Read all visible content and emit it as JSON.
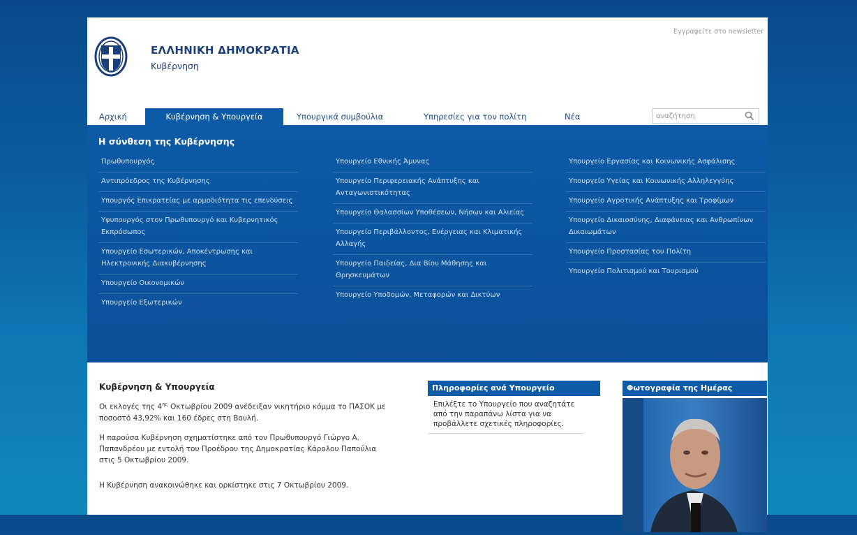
{
  "header": {
    "title": "ΕΛΛΗΝΙΚΗ ΔΗΜΟΚΡΑΤΙΑ",
    "subtitle": "Κυβέρνηση",
    "newsletter": "Εγγραφείτε στο newsletter",
    "logo_icon": "greek-coat-of-arms"
  },
  "nav": {
    "items": [
      {
        "label": "Αρχική"
      },
      {
        "label": "Κυβέρνηση & Υπουργεία",
        "active": true
      },
      {
        "label": "Υπουργικά συμβούλια"
      },
      {
        "label": "Υπηρεσίες για τον πολίτη"
      },
      {
        "label": "Νέα"
      }
    ],
    "search_placeholder": "αναζήτηση",
    "search_icon": "magnifier-icon"
  },
  "mega": {
    "title": "Η σύνθεση της Κυβέρνησης",
    "col1": [
      "Πρωθυπουργός",
      "Αντιπρόεδρος της Κυβέρνησης",
      "Υπουργός Επικρατείας με αρμοδιότητα τις επενδύσεις",
      "Υφυπουργός στον Πρωθυπουργό και Κυβερνητικός Εκπρόσωπος",
      "Υπουργείο Εσωτερικών, Αποκέντρωσης και Ηλεκτρονικής Διακυβέρνησης",
      "Υπουργείο Οικονομικών",
      "Υπουργείο Εξωτερικών"
    ],
    "col2": [
      "Υπουργείο Εθνικής Άμυνας",
      "Υπουργείο Περιφερειακής Ανάπτυξης και Ανταγωνιστικότητας",
      "Υπουργείο Θαλασσίων Υποθέσεων, Νήσων και Αλιείας",
      "Υπουργείο Περιβάλλοντος, Ενέργειας και Κλιματικής Αλλαγής",
      "Υπουργείο Παιδείας, Δια Βίου Μάθησης και Θρησκευμάτων",
      "Υπουργείο Υποδομών, Μεταφορών και Δικτύων"
    ],
    "col3": [
      "Υπουργείο Εργασίας και Κοινωνικής Ασφάλισης",
      "Υπουργείο Υγείας και Κοινωνικής Αλληλεγγύης",
      "Υπουργείο Αγροτικής Ανάπτυξης και Τροφίμων",
      "Υπουργείο Δικαιοσύνης, Διαφάνειας και Ανθρωπίνων Δικαιωμάτων",
      "Υπουργείο Προστασίας του Πολίτη",
      "Υπουργείο Πολιτισμού και Τουρισμού"
    ]
  },
  "content": {
    "title": "Κυβέρνηση & Υπουργεία",
    "p1_before": "Οι εκλογές της 4",
    "p1_sup": "ης",
    "p1_after": " Οκτωβρίου 2009 ανέδειξαν νικητήριο κόμμα το ΠΑΣΟΚ με ποσοστό 43,92% και 160 έδρες στη Βουλή.",
    "p2": "Η παρούσα Κυβέρνηση σχηματίστηκε από τον Πρωθυπουργό Γιώργο Α. Παπανδρέου με εντολή του Προέδρου της Δημοκρατίας Κάρολου Παπούλια στις 5 Οκτωβρίου 2009.",
    "p3": "Η Κυβέρνηση ανακοινώθηκε και ορκίστηκε στις 7 Οκτωβρίου 2009."
  },
  "info_box": {
    "title": "Πληροφορίες ανά Υπουργείο",
    "text": "Επιλέξτε το Υπουργείο που αναζητάτε από την παραπάνω λίστα για να προβάλλετε σχετικές πληροφορίες."
  },
  "photo_box": {
    "title": "Φωτογραφία της Ημέρας"
  },
  "colors": {
    "primary_blue": "#0d5aa6",
    "brand_text": "#1b3f7a",
    "background_top": "#0a4a8a",
    "background_bottom": "#1188b9"
  }
}
